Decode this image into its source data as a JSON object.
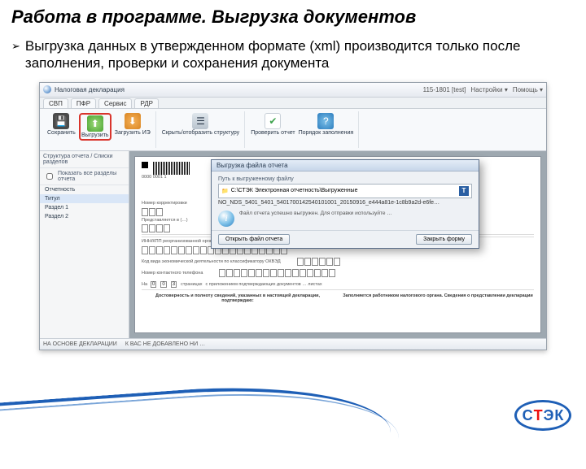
{
  "slide": {
    "title": "Работа в программе. Выгрузка документов",
    "bullet_marker": "➢",
    "bullet_text": "Выгрузка данных в утвержденном формате (xml) производится только после заполнения, проверки и сохранения документа"
  },
  "titlebar": {
    "app_name": "Налоговая декларация",
    "user_info": "115-1801 [test]",
    "menu_settings": "Настройки ▾",
    "menu_help": "Помощь ▾"
  },
  "tabs": {
    "t0": "СВП",
    "t1": "ПФР",
    "t2": "Сервис",
    "t3": "РДР"
  },
  "ribbon": {
    "save": "Сохранить",
    "upload": "Выгрузить",
    "download": "Загрузить ИЭ",
    "struct": "Скрыть/отобразить структуру",
    "check": "Проверить отчет",
    "help": "Порядок заполнения"
  },
  "side": {
    "head": "Структура отчета / Списки разделов",
    "chk": "Показать все разделы отчета",
    "i0": "Отчетность",
    "i1": "Титул",
    "i2": "Раздел 1",
    "i3": "Раздел 2"
  },
  "paper": {
    "barcode_num": "0000 0001 1",
    "field1": "Номер корректировки",
    "field2": "Представляется в (…)",
    "row_label": "ИНН/КПП реорганизованной организации …",
    "row2": "Код вида экономической деятельности по классификатору ОКВЭД",
    "row3": "Номер контактного телефона",
    "on": "На",
    "pages_badge_1": "0",
    "pages_badge_2": "0",
    "pages_badge_3": "3",
    "pages": "страницах",
    "pages_tail": "с приложением подтверждающих документов … листах",
    "col1": "Достоверность и полноту сведений, указанных в настоящей декларации, подтверждаю:",
    "col2": "Заполняется работником налогового органа. Сведения о представлении декларации"
  },
  "modal": {
    "title": "Выгрузка файла отчета",
    "caption": "Путь к выгруженному файлу",
    "folder": "C:\\СТЭК Электронная отчетность\\Выгруженные",
    "file": "NO_NDS_5401_5401_5401700142540101001_20150916_e444a81e-1c8b9a2d-e6fe…",
    "info_msg": "Файл отчета успешно выгружен. Для отправки используйте …",
    "btn_open": "Открыть файл отчета",
    "btn_close": "Закрыть форму"
  },
  "status": {
    "left": "НА ОСНОВЕ ДЕКЛАРАЦИИ",
    "mid": "К ВАС НЕ ДОБАВЛЕНО НИ …"
  },
  "logo": {
    "c1": "С",
    "c2": "Т",
    "c3": "Э",
    "c4": "К"
  }
}
